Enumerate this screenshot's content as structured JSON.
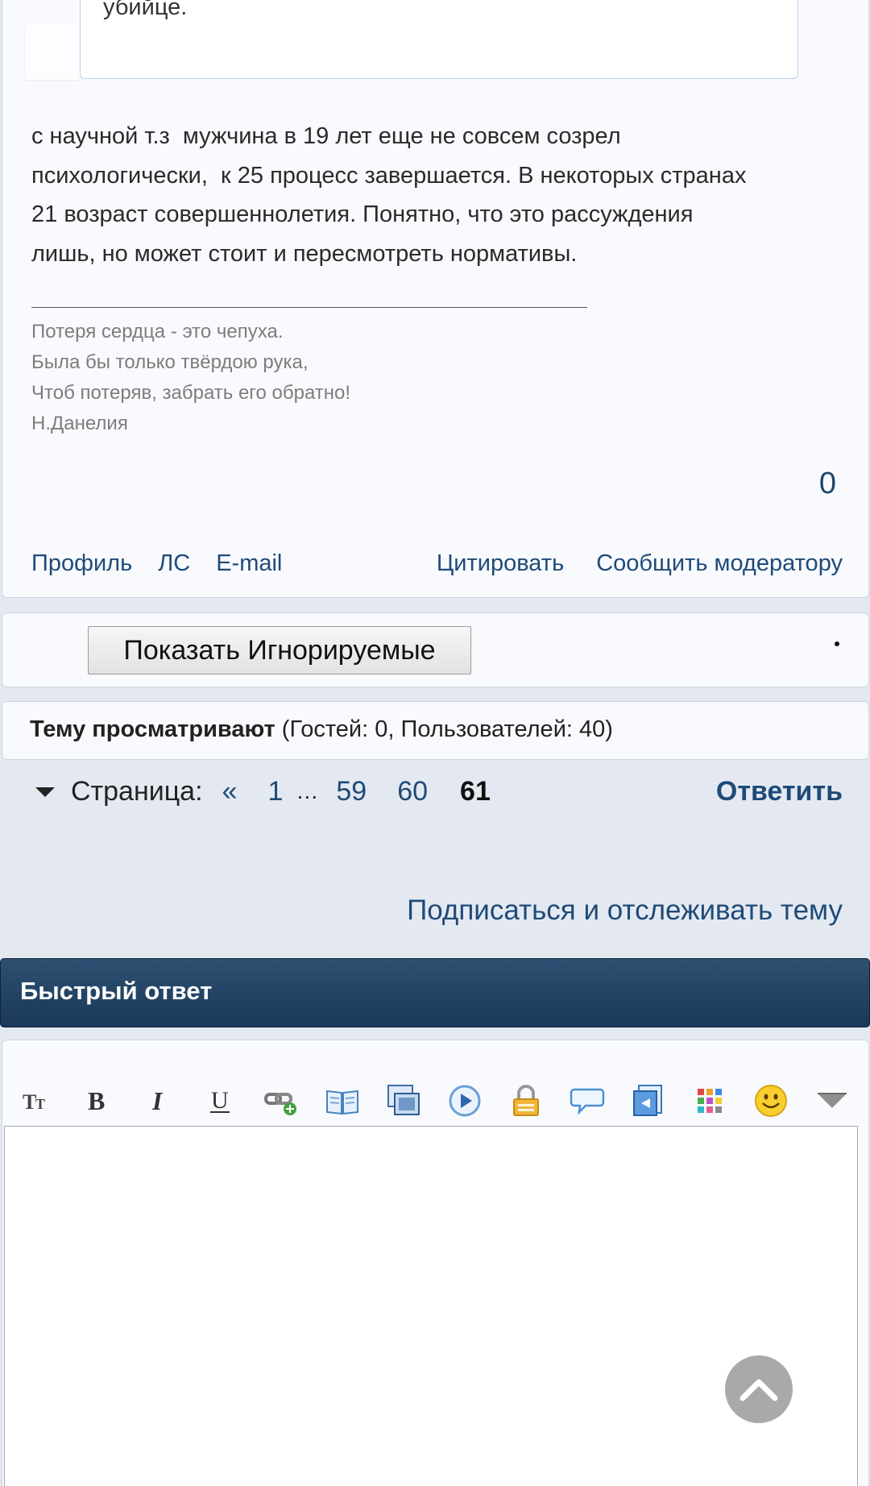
{
  "post": {
    "quote_text": "убийце.",
    "body": "с научной т.з  мужчина в 19 лет еще не совсем созрел\nпсихологически,  к 25 процесс завершается. В некоторых странах\n21 возраст совершеннолетия. Понятно, что это рассуждения\nлишь, но может стоит и пересмотреть нормативы.",
    "signature": [
      "Потеря сердца - это чепуха.",
      "Была бы только твёрдою рука,",
      "Чтоб потеряв, забрать его обратно!",
      "Н.Данелия"
    ],
    "reputation": "0",
    "actions_left": [
      "Профиль",
      "ЛС",
      "E-mail"
    ],
    "actions_right": [
      "Цитировать",
      "Сообщить модератору"
    ]
  },
  "ignored": {
    "button_label": "Показать Игнорируемые"
  },
  "viewers": {
    "label": "Тему просматривают",
    "details": " (Гостей: 0, Пользователей: 40)"
  },
  "pagination": {
    "label": "Страница:",
    "prev": "«",
    "pages": [
      "1",
      "59",
      "60"
    ],
    "ellipsis": "…",
    "current": "61",
    "reply": "Ответить"
  },
  "subscribe": "Подписаться и отслеживать тему",
  "quick_reply": {
    "title": "Быстрый ответ",
    "toolbar_icons": [
      "font-size-icon",
      "bold-icon",
      "italic-icon",
      "underline-icon",
      "insert-link-icon",
      "book-icon",
      "image-icon",
      "media-play-icon",
      "lock-icon",
      "speech-bubble-icon",
      "code-icon",
      "color-grid-icon",
      "smiley-icon",
      "more-dropdown-icon"
    ]
  },
  "colors": {
    "link": "#1f4a78",
    "header_bg": "#1e3c5c",
    "page_bg": "#e4e9f1",
    "card_bg": "#f8fafd"
  }
}
